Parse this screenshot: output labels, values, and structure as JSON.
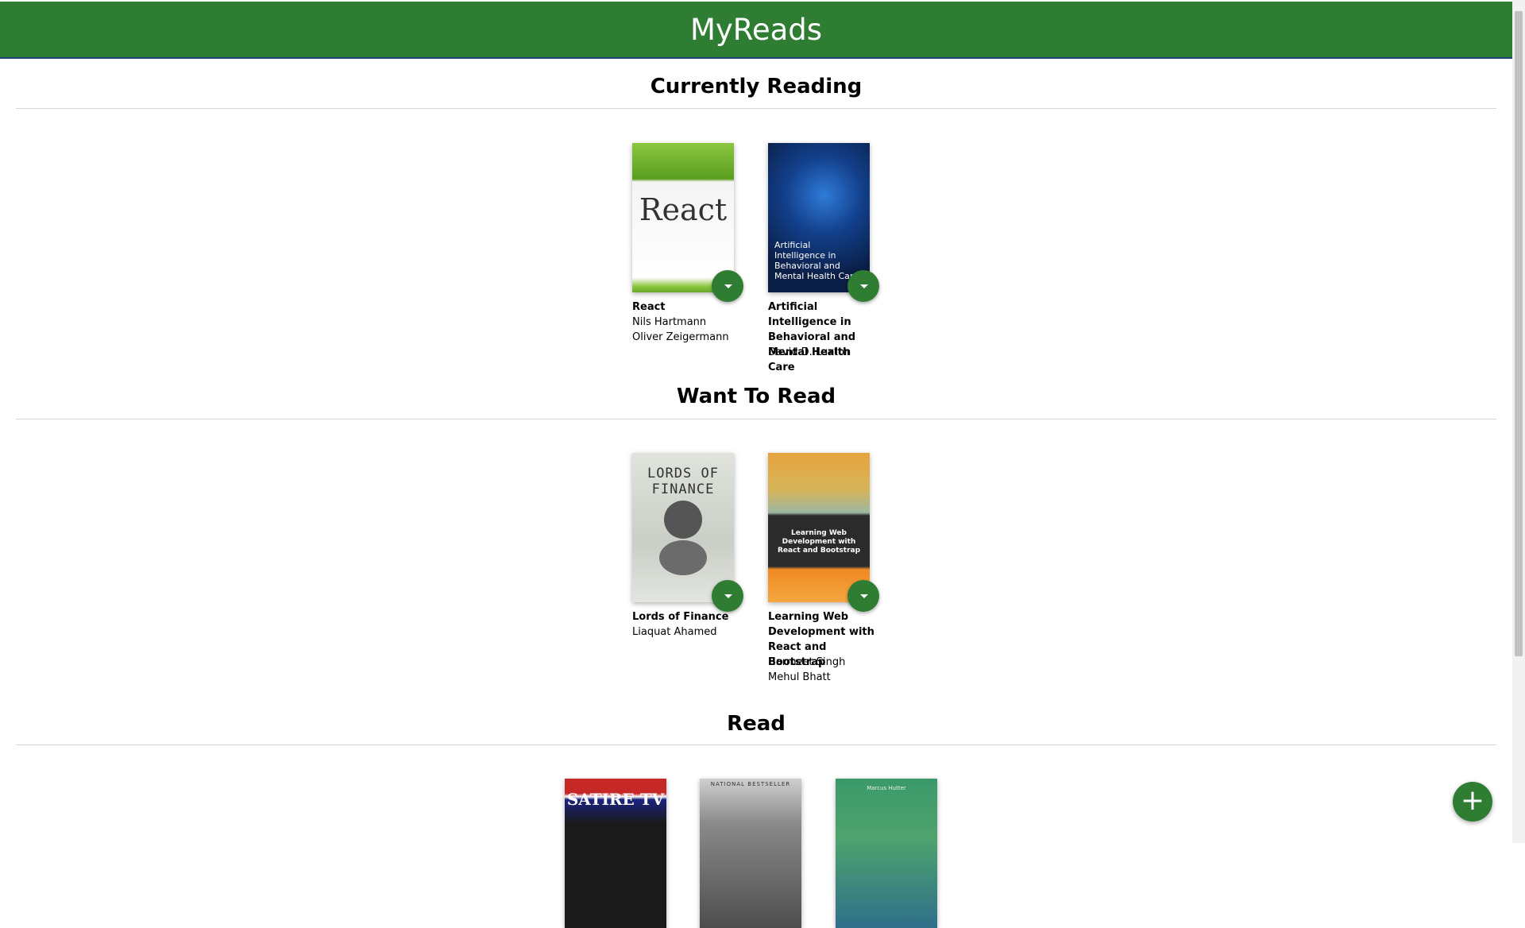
{
  "app_title": "MyReads",
  "shelves": [
    {
      "title": "Currently Reading",
      "books": [
        {
          "title": "React",
          "authors": [
            "Nils Hartmann",
            "Oliver Zeigermann"
          ],
          "cover_text": "React"
        },
        {
          "title": "Artificial Intelligence in Behavioral and Mental Health Care",
          "authors": [
            "David D. Luxton"
          ],
          "cover_text": "Artificial Intelligence in Behavioral and Mental Health Care"
        }
      ]
    },
    {
      "title": "Want To Read",
      "books": [
        {
          "title": "Lords of Finance",
          "authors": [
            "Liaquat Ahamed"
          ],
          "cover_text": "LORDS OF FINANCE"
        },
        {
          "title": "Learning Web Development with React and Bootstrap",
          "authors": [
            "Harmeet Singh",
            "Mehul Bhatt"
          ],
          "cover_text": "Learning Web Development with React and Bootstrap"
        }
      ]
    },
    {
      "title": "Read",
      "books": [
        {
          "cover_text": "SATIRE TV"
        },
        {
          "cover_text": "NATIONAL BESTSELLER"
        },
        {
          "cover_text": "Marcus Hutter"
        }
      ]
    }
  ],
  "add_button_label": "+",
  "colors": {
    "header": "#2e7d32",
    "button": "#2e7d32"
  }
}
